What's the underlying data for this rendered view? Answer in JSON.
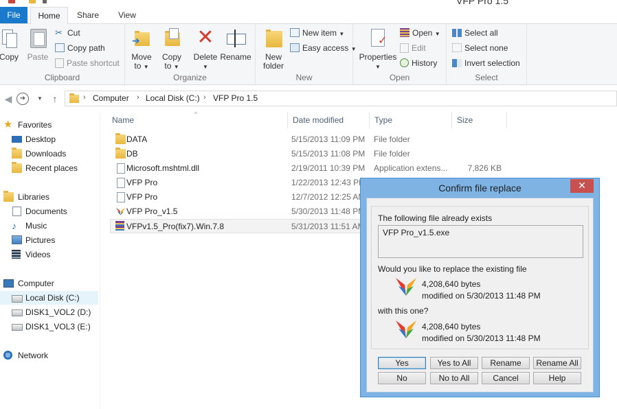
{
  "window": {
    "title": "VFP Pro 1.5"
  },
  "tabs": [
    "File",
    "Home",
    "Share",
    "View"
  ],
  "ribbon": {
    "clipboard": {
      "caption": "Clipboard",
      "copy": "Copy",
      "paste": "Paste",
      "cut": "Cut",
      "copy_path": "Copy path",
      "paste_shortcut": "Paste shortcut"
    },
    "organize": {
      "caption": "Organize",
      "move_to": "Move",
      "move_to_2": "to",
      "copy_to": "Copy",
      "copy_to_2": "to",
      "delete": "Delete",
      "rename": "Rename"
    },
    "new": {
      "caption": "New",
      "new_folder": "New",
      "new_folder_2": "folder",
      "new_item": "New item",
      "easy_access": "Easy access"
    },
    "open": {
      "caption": "Open",
      "properties": "Properties",
      "open": "Open",
      "edit": "Edit",
      "history": "History"
    },
    "select": {
      "caption": "Select",
      "select_all": "Select all",
      "select_none": "Select none",
      "invert": "Invert selection"
    }
  },
  "address": {
    "crumbs": [
      "Computer",
      "Local Disk (C:)",
      "VFP Pro 1.5"
    ]
  },
  "nav": {
    "favorites": "Favorites",
    "favorites_items": [
      "Desktop",
      "Downloads",
      "Recent places"
    ],
    "libraries": "Libraries",
    "libraries_items": [
      "Documents",
      "Music",
      "Pictures",
      "Videos"
    ],
    "computer": "Computer",
    "computer_items": [
      "Local Disk (C:)",
      "DISK1_VOL2 (D:)",
      "DISK1_VOL3 (E:)"
    ],
    "network": "Network"
  },
  "columns": {
    "name": "Name",
    "date": "Date modified",
    "type": "Type",
    "size": "Size"
  },
  "files": [
    {
      "name": "DATA",
      "date": "5/15/2013 11:09 PM",
      "type": "File folder",
      "size": "",
      "icon": "folder-icon"
    },
    {
      "name": "DB",
      "date": "5/15/2013 11:08 PM",
      "type": "File folder",
      "size": "",
      "icon": "folder-icon"
    },
    {
      "name": "Microsoft.mshtml.dll",
      "date": "2/19/2011 10:39 PM",
      "type": "Application extens...",
      "size": "7,826 KB",
      "icon": "dll-file-icon"
    },
    {
      "name": "VFP Pro",
      "date": "1/22/2013 12:43 PM",
      "type": "",
      "size": "",
      "icon": "generic-file-icon"
    },
    {
      "name": "VFP Pro",
      "date": "12/7/2012 12:25 AM",
      "type": "",
      "size": "",
      "icon": "generic-file-icon"
    },
    {
      "name": "VFP Pro_v1.5",
      "date": "5/30/2013 11:48 PM",
      "type": "",
      "size": "",
      "icon": "butterfly-app-icon"
    },
    {
      "name": "VFPv1.5_Pro(fix7).Win.7.8",
      "date": "5/31/2013 11:51 AM",
      "type": "",
      "size": "",
      "icon": "winrar-archive-icon"
    }
  ],
  "dialog": {
    "title": "Confirm file replace",
    "close": "✕",
    "exists_text": "The following file already exists",
    "filename": "VFP Pro_v1.5.exe",
    "question": "Would you like to replace the existing file",
    "existing": {
      "size": "4,208,640 bytes",
      "modified": "modified on 5/30/2013 11:48 PM"
    },
    "with_text": "with this one?",
    "replacement": {
      "size": "4,208,640 bytes",
      "modified": "modified on 5/30/2013 11:48 PM"
    },
    "buttons": [
      "Yes",
      "Yes to All",
      "Rename",
      "Rename All",
      "No",
      "No to All",
      "Cancel",
      "Help"
    ]
  }
}
